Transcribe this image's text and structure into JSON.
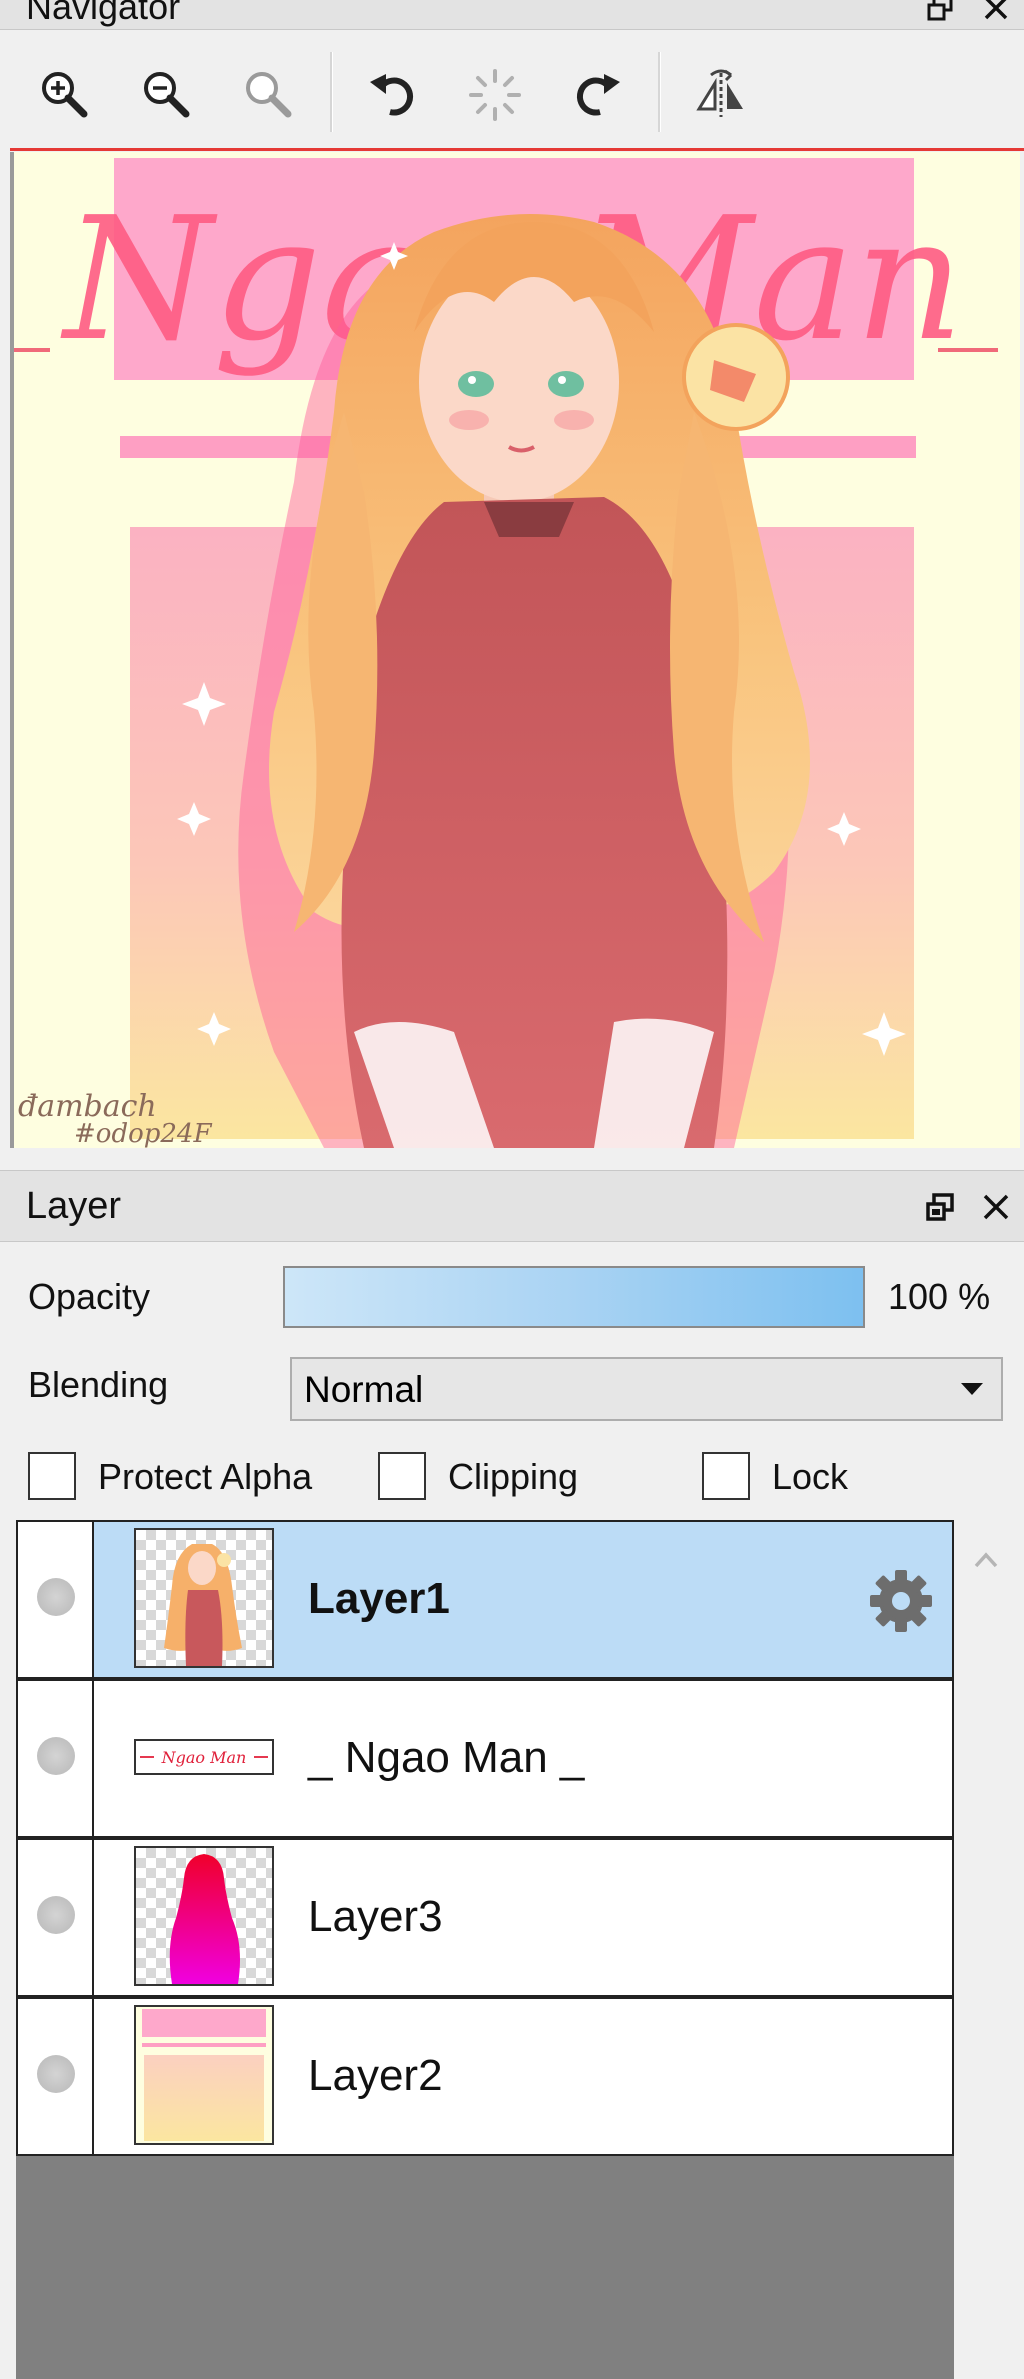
{
  "navigator": {
    "title": "Navigator",
    "tools": [
      {
        "name": "zoom-in-icon",
        "tooltip": "Zoom In"
      },
      {
        "name": "zoom-out-icon",
        "tooltip": "Zoom Out"
      },
      {
        "name": "zoom-fit-icon",
        "tooltip": "Fit"
      },
      {
        "name": "rotate-left-icon",
        "tooltip": "Rotate Left"
      },
      {
        "name": "rotate-reset-icon",
        "tooltip": "Reset Rotation"
      },
      {
        "name": "rotate-right-icon",
        "tooltip": "Rotate Right"
      },
      {
        "name": "flip-horizontal-icon",
        "tooltip": "Flip Horizontal"
      }
    ],
    "preview": {
      "title_art": "Ngao Man",
      "signature_line1": "đambach",
      "signature_line2": "#odop24F"
    }
  },
  "layer_panel": {
    "title": "Layer",
    "opacity_label": "Opacity",
    "opacity_value": "100 %",
    "opacity_fraction": 1.0,
    "blending_label": "Blending",
    "blending_value": "Normal",
    "protect_alpha_label": "Protect Alpha",
    "clipping_label": "Clipping",
    "lock_label": "Lock",
    "protect_alpha_checked": false,
    "clipping_checked": false,
    "lock_checked": false,
    "layers": [
      {
        "name": "Layer1",
        "selected": true,
        "has_settings": true
      },
      {
        "name": "_ Ngao Man _",
        "selected": false
      },
      {
        "name": "Layer3",
        "selected": false
      },
      {
        "name": "Layer2",
        "selected": false
      }
    ]
  },
  "colors": {
    "selection": "#bcdcf6",
    "accent_red": "#e53935",
    "opacity_bar": "#7dc0f0",
    "canvas_bg": "#fefee0",
    "title_pink": "#ff5c84"
  }
}
